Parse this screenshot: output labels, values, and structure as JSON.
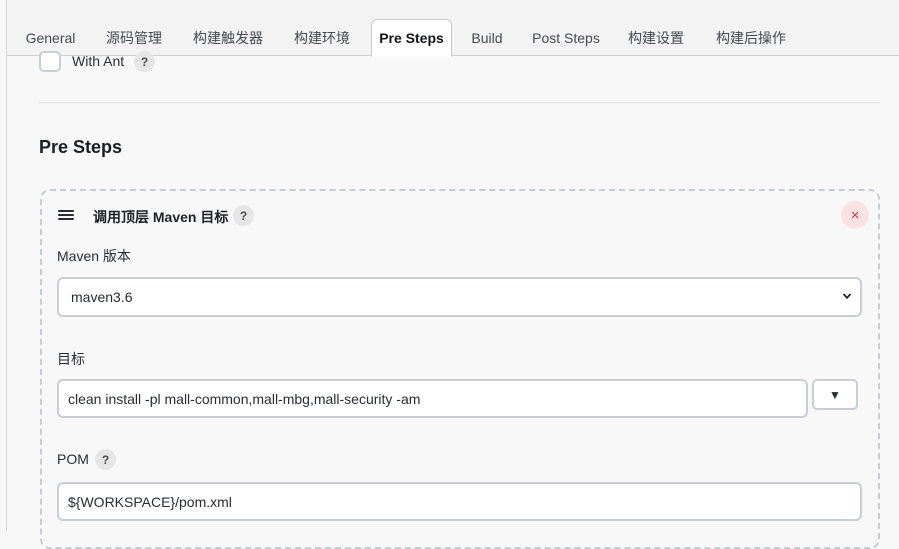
{
  "tabs": [
    {
      "label": "General"
    },
    {
      "label": "源码管理"
    },
    {
      "label": "构建触发器"
    },
    {
      "label": "构建环境"
    },
    {
      "label": "Pre Steps",
      "active": true
    },
    {
      "label": "Build"
    },
    {
      "label": "Post Steps"
    },
    {
      "label": "构建设置"
    },
    {
      "label": "构建后操作"
    }
  ],
  "with_ant": {
    "label": "With Ant",
    "checked": false,
    "help": "?"
  },
  "section": {
    "title": "Pre Steps"
  },
  "step": {
    "title": "调用顶层 Maven 目标",
    "help": "?",
    "close": "×",
    "maven_version": {
      "label": "Maven 版本",
      "value": "maven3.6"
    },
    "goals": {
      "label": "目标",
      "value": "clean install -pl mall-common,mall-mbg,mall-security -am",
      "expand": "▼"
    },
    "pom": {
      "label": "POM",
      "help": "?",
      "value": "${WORKSPACE}/pom.xml"
    }
  }
}
